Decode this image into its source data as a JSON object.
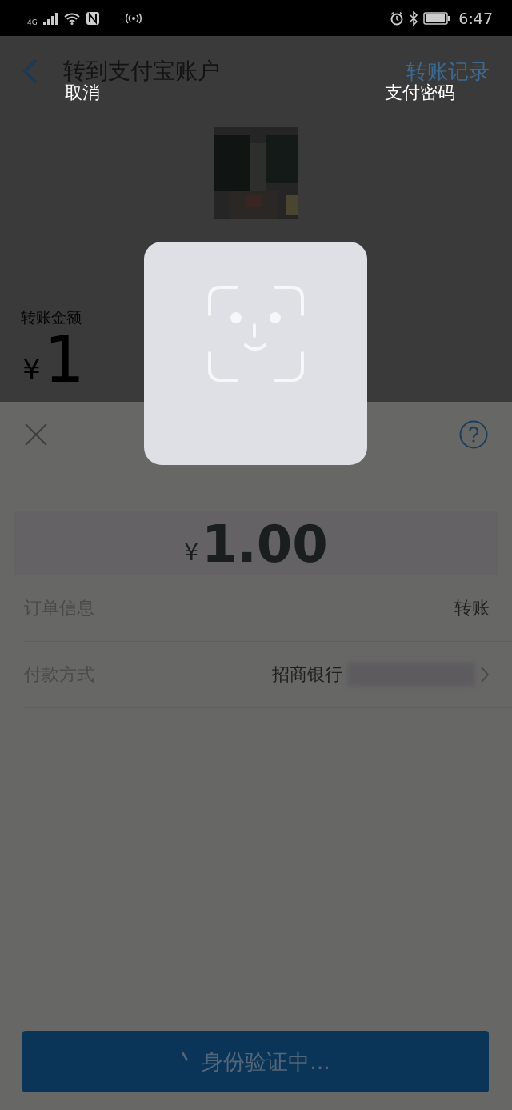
{
  "status_bar": {
    "time": "6:47",
    "network": "4G"
  },
  "header": {
    "title": "转到支付宝账户",
    "action": "转账记录"
  },
  "face_overlay": {
    "cancel": "取消",
    "password": "支付密码"
  },
  "transfer": {
    "label": "转账金额",
    "currency": "¥",
    "amount": "1"
  },
  "sheet": {
    "amount_currency": "¥",
    "amount": "1.00",
    "rows": [
      {
        "label": "订单信息",
        "value": "转账",
        "masked": false,
        "chevron": false
      },
      {
        "label": "付款方式",
        "value": "招商银行",
        "masked": true,
        "chevron": true
      }
    ],
    "button": {
      "label": "身份验证中...",
      "busy": true
    }
  }
}
